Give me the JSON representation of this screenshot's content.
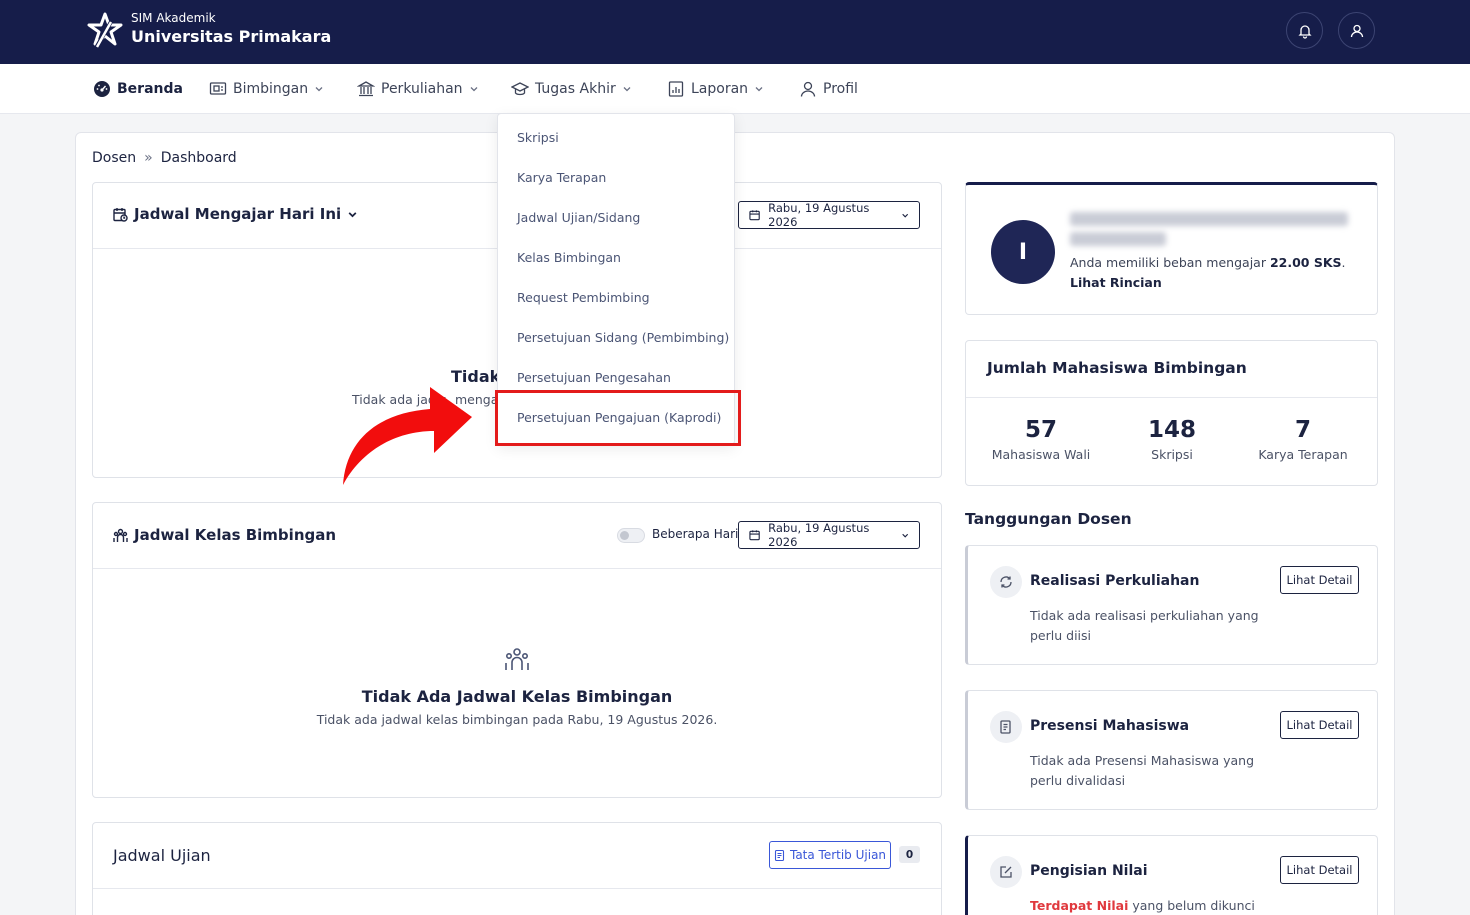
{
  "header": {
    "app_small": "SIM Akademik",
    "app_name": "Universitas Primakara",
    "icons": [
      "bell-icon",
      "user-icon"
    ],
    "bg_color": "#161d4a"
  },
  "nav": {
    "items": [
      {
        "label": "Beranda",
        "icon": "dashboard-icon",
        "active": true
      },
      {
        "label": "Bimbingan",
        "icon": "board-icon"
      },
      {
        "label": "Perkuliahan",
        "icon": "building-icon"
      },
      {
        "label": "Tugas Akhir",
        "icon": "graduation-cap-icon"
      },
      {
        "label": "Laporan",
        "icon": "report-icon"
      },
      {
        "label": "Profil",
        "icon": "user-icon"
      }
    ]
  },
  "breadcrumb": {
    "root": "Dosen",
    "sep": "»",
    "current": "Dashboard"
  },
  "dropdown": {
    "items": [
      "Skripsi",
      "Karya Terapan",
      "Jadwal Ujian/Sidang",
      "Kelas Bimbingan",
      "Request Pembimbing",
      "Persetujuan Sidang (Pembimbing)",
      "Persetujuan Pengesahan",
      "Persetujuan Pengajuan (Kaprodi)"
    ],
    "highlighted": "Persetujuan Pengajuan (Kaprodi)",
    "highlight_color": "#e31b1b"
  },
  "jadwal_mengajar": {
    "title": "Jadwal Mengajar Hari Ini",
    "date": "Rabu, 19 Agustus 2026",
    "empty_title_visible": "Tidak",
    "empty_sub_left": "Tidak ada jadw",
    "empty_sub_right": "menga"
  },
  "jadwal_kelas": {
    "title": "Jadwal Kelas Bimbingan",
    "toggle_label": "Beberapa Hari",
    "date": "Rabu, 19 Agustus 2026",
    "empty_title": "Tidak Ada Jadwal Kelas Bimbingan",
    "empty_sub": "Tidak ada jadwal kelas bimbingan pada Rabu, 19 Agustus 2026."
  },
  "jadwal_ujian": {
    "title": "Jadwal Ujian",
    "button": "Tata Tertib Ujian",
    "count": "0"
  },
  "profile": {
    "initial": "I",
    "load_prefix": "Anda memiliki beban mengajar ",
    "load_value": "22.00 SKS",
    "load_suffix": ".",
    "link": "Lihat Rincian"
  },
  "bimbingan": {
    "title": "Jumlah Mahasiswa Bimbingan",
    "stats": [
      {
        "value": "57",
        "label": "Mahasiswa Wali"
      },
      {
        "value": "148",
        "label": "Skripsi"
      },
      {
        "value": "7",
        "label": "Karya Terapan"
      }
    ]
  },
  "tanggungan": {
    "title": "Tanggungan Dosen",
    "detail_label": "Lihat Detail",
    "items": [
      {
        "title": "Realisasi Perkuliahan",
        "desc": "Tidak ada realisasi perkuliahan yang perlu diisi",
        "icon": "refresh-icon"
      },
      {
        "title": "Presensi Mahasiswa",
        "desc": "Tidak ada Presensi Mahasiswa yang perlu divalidasi",
        "icon": "document-icon"
      },
      {
        "title": "Pengisian Nilai",
        "desc_red": "Terdapat Nilai",
        "desc": " yang belum dikunci",
        "icon": "edit-icon"
      }
    ]
  }
}
